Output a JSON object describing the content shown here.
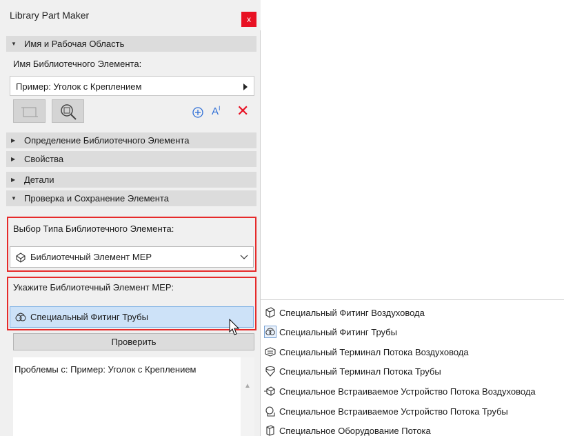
{
  "window": {
    "title": "Library Part Maker",
    "close_label": "x"
  },
  "sections": {
    "name_and_workspace": "Имя и Рабочая Область",
    "definition": "Определение Библиотечного Элемента",
    "properties": "Свойства",
    "details": "Детали",
    "check_and_save": "Проверка и Сохранение Элемента"
  },
  "name_field": {
    "label": "Имя Библиотечного Элемента:",
    "value": "Пример: Уголок с Креплением"
  },
  "toolbar": {
    "add_icon": "plus-circle-icon",
    "text_icon": "text-size-icon",
    "delete_icon": "delete-x-icon",
    "delete_color": "#e81123",
    "accent_color": "#2f6fd6"
  },
  "type_select": {
    "label": "Выбор Типа Библиотечного Элемента:",
    "value": "Библиотечный Элемент MEP"
  },
  "mep_select": {
    "label": "Укажите Библиотечный Элемент MEP:",
    "value": "Специальный Фитинг Трубы"
  },
  "check_button": "Проверить",
  "problems_text": "Проблемы с: Пример: Уголок с Креплением",
  "menu": {
    "items": [
      "Специальный Фитинг Воздуховода",
      "Специальный Фитинг Трубы",
      "Специальный Терминал Потока Воздуховода",
      "Специальный Терминал Потока Трубы",
      "Специальное Встраиваемое Устройство Потока Воздуховода",
      "Специальное Встраиваемое Устройство Потока Трубы",
      "Специальное Оборудование Потока"
    ],
    "selected_index": 1
  },
  "highlight_color": "#e62a2a"
}
